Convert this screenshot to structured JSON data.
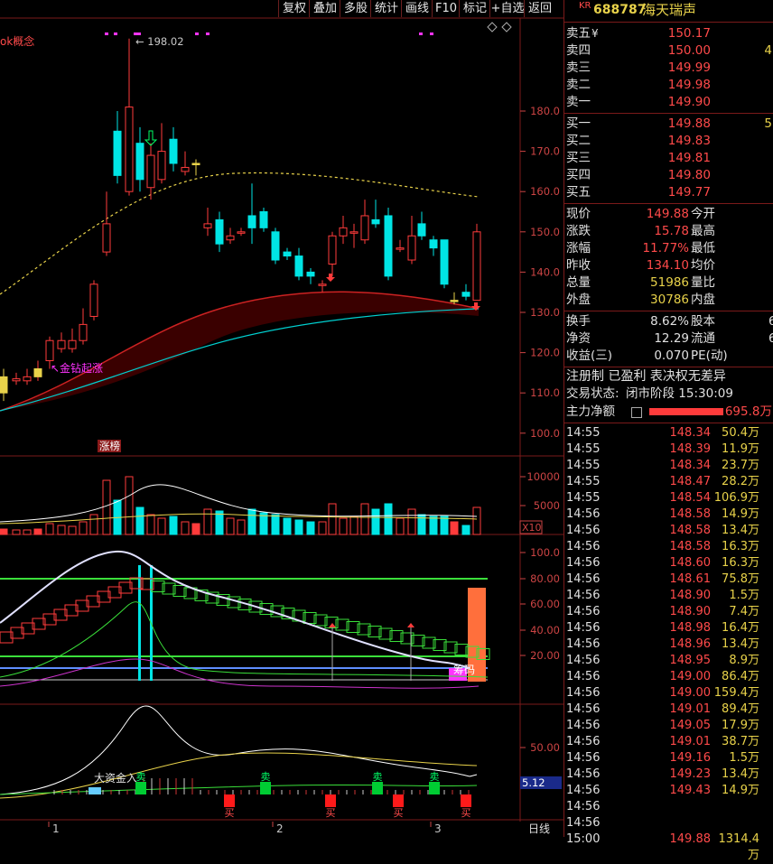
{
  "toolbar": {
    "buttons": [
      "复权",
      "叠加",
      "多股",
      "统计",
      "画线",
      "F10",
      "标记",
      "+自选",
      "返回"
    ]
  },
  "stock": {
    "prefix": "KR",
    "code": "688787",
    "name": "海天瑞声"
  },
  "main_chart": {
    "concept_label": "ok概念",
    "high_label": "198.02",
    "signal_label": "金钻起涨",
    "ranking_label": "涨榜",
    "price_ticks": [
      "180.0",
      "170.0",
      "160.0",
      "150.0",
      "140.0",
      "130.0",
      "120.0",
      "110.0",
      "100.0"
    ]
  },
  "volume_panel": {
    "ticks": [
      "10000",
      "5000"
    ],
    "unit": "X10"
  },
  "indicator_panel": {
    "ticks": [
      "100.0",
      "80.00",
      "60.00",
      "40.00",
      "20.00"
    ],
    "tag": "筹码"
  },
  "bottom_panel": {
    "tick": "50.00",
    "value": "5.12",
    "labels": [
      "大资金入"
    ],
    "buy_sell": [
      "卖",
      "卖",
      "卖",
      "卖",
      "买",
      "买",
      "买",
      "买"
    ]
  },
  "date_axis": {
    "labels": [
      "1",
      "2",
      "3"
    ],
    "period": "日线"
  },
  "orderbook": {
    "asks": [
      {
        "label": "卖五",
        "flag": "¥",
        "price": "150.17",
        "vol": ""
      },
      {
        "label": "卖四",
        "flag": "",
        "price": "150.00",
        "vol": "4"
      },
      {
        "label": "卖三",
        "flag": "",
        "price": "149.99",
        "vol": ""
      },
      {
        "label": "卖二",
        "flag": "",
        "price": "149.98",
        "vol": ""
      },
      {
        "label": "卖一",
        "flag": "",
        "price": "149.90",
        "vol": ""
      }
    ],
    "bids": [
      {
        "label": "买一",
        "price": "149.88",
        "vol": "5"
      },
      {
        "label": "买二",
        "price": "149.83",
        "vol": ""
      },
      {
        "label": "买三",
        "price": "149.81",
        "vol": ""
      },
      {
        "label": "买四",
        "price": "149.80",
        "vol": ""
      },
      {
        "label": "买五",
        "price": "149.77",
        "vol": ""
      }
    ]
  },
  "quote": {
    "rows": [
      {
        "l1": "现价",
        "v1": "149.88",
        "l2": "今开"
      },
      {
        "l1": "涨跌",
        "v1": "15.78",
        "l2": "最高"
      },
      {
        "l1": "涨幅",
        "v1": "11.77%",
        "l2": "最低"
      },
      {
        "l1": "昨收",
        "v1": "134.10",
        "l2": "均价"
      },
      {
        "l1": "总量",
        "v1": "51986",
        "l2": "量比"
      },
      {
        "l1": "外盘",
        "v1": "30786",
        "l2": "内盘"
      }
    ],
    "rows2": [
      {
        "l1": "换手",
        "v1": "8.62%",
        "l2": "股本",
        "v2": "6"
      },
      {
        "l1": "净资",
        "v1": "12.29",
        "l2": "流通",
        "v2": "6"
      },
      {
        "l1": "收益(三)",
        "v1": "0.070",
        "l2": "PE(动)",
        "v2": ""
      }
    ],
    "info1": "注册制 已盈利 表决权无差异",
    "info2_label": "交易状态:",
    "info2_value": "闭市阶段 15:30:09",
    "net_label": "主力净额",
    "net_value": "695.8万"
  },
  "ticks": [
    {
      "t": "14:55",
      "p": "148.34",
      "v": "50.4万"
    },
    {
      "t": "14:55",
      "p": "148.39",
      "v": "11.9万"
    },
    {
      "t": "14:55",
      "p": "148.34",
      "v": "23.7万"
    },
    {
      "t": "14:55",
      "p": "148.47",
      "v": "28.2万"
    },
    {
      "t": "14:55",
      "p": "148.54",
      "v": "106.9万"
    },
    {
      "t": "14:56",
      "p": "148.58",
      "v": "14.9万"
    },
    {
      "t": "14:56",
      "p": "148.58",
      "v": "13.4万"
    },
    {
      "t": "14:56",
      "p": "148.58",
      "v": "16.3万"
    },
    {
      "t": "14:56",
      "p": "148.60",
      "v": "16.3万"
    },
    {
      "t": "14:56",
      "p": "148.61",
      "v": "75.8万"
    },
    {
      "t": "14:56",
      "p": "148.90",
      "v": "1.5万"
    },
    {
      "t": "14:56",
      "p": "148.90",
      "v": "7.4万"
    },
    {
      "t": "14:56",
      "p": "148.98",
      "v": "16.4万"
    },
    {
      "t": "14:56",
      "p": "148.96",
      "v": "13.4万"
    },
    {
      "t": "14:56",
      "p": "148.95",
      "v": "8.9万"
    },
    {
      "t": "14:56",
      "p": "149.00",
      "v": "86.4万"
    },
    {
      "t": "14:56",
      "p": "149.00",
      "v": "159.4万"
    },
    {
      "t": "14:56",
      "p": "149.01",
      "v": "89.4万"
    },
    {
      "t": "14:56",
      "p": "149.05",
      "v": "17.9万"
    },
    {
      "t": "14:56",
      "p": "149.01",
      "v": "38.7万"
    },
    {
      "t": "14:56",
      "p": "149.16",
      "v": "1.5万"
    },
    {
      "t": "14:56",
      "p": "149.23",
      "v": "13.4万"
    },
    {
      "t": "14:56",
      "p": "149.43",
      "v": "14.9万"
    },
    {
      "t": "14:56",
      "p": "",
      "v": ""
    },
    {
      "t": "14:56",
      "p": "",
      "v": ""
    },
    {
      "t": "15:00",
      "p": "149.88",
      "v": "1314.4万"
    }
  ],
  "colors": {
    "up": "#ff3b3b",
    "down": "#00e5e5",
    "bg": "#000000",
    "grid": "#7a1a1a",
    "ma": "#e8d24a"
  }
}
